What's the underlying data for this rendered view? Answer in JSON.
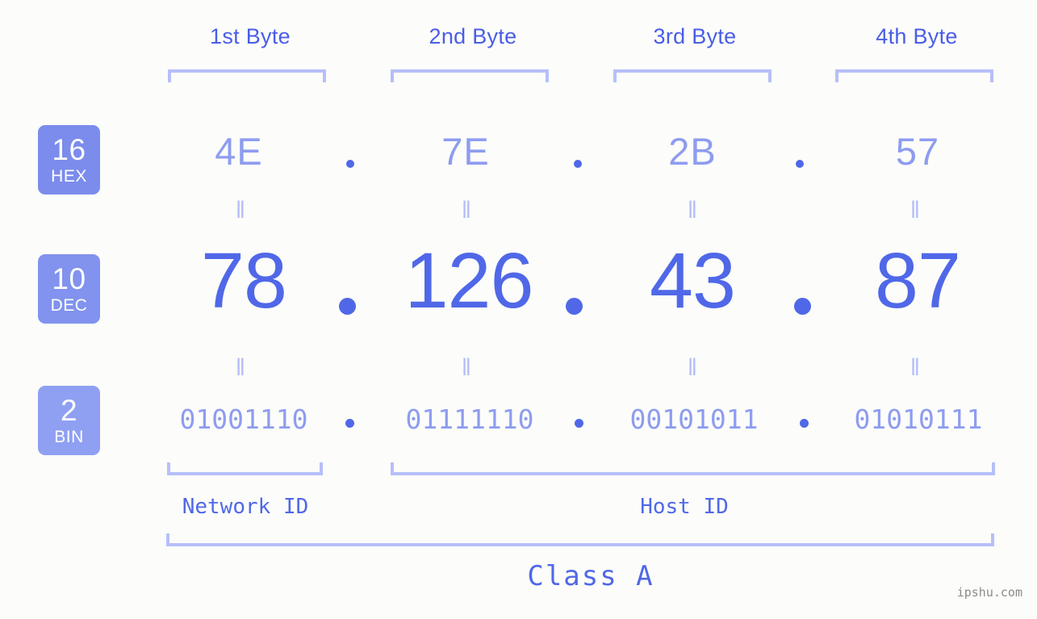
{
  "theme": {
    "background": "#fcfdfa",
    "accent_strong": "#5068e8",
    "accent_light": "#8e9cf0",
    "accent_pale": "#b6bffa",
    "badge_fill_hex": "#7b8cec",
    "badge_fill_dec": "#8193ee",
    "badge_fill_bin": "#8fa0f3",
    "header_text": "#4a5de8",
    "watermark_color": "#8a8a8a"
  },
  "header": {
    "bytes": [
      {
        "label": "1st Byte"
      },
      {
        "label": "2nd Byte"
      },
      {
        "label": "3rd Byte"
      },
      {
        "label": "4th Byte"
      }
    ]
  },
  "rows": {
    "hex": {
      "badge": {
        "num": "16",
        "name": "HEX"
      },
      "values": [
        "4E",
        "7E",
        "2B",
        "57"
      ],
      "separator": "."
    },
    "dec": {
      "badge": {
        "num": "10",
        "name": "DEC"
      },
      "values": [
        "78",
        "126",
        "43",
        "87"
      ],
      "separator": "."
    },
    "bin": {
      "badge": {
        "num": "2",
        "name": "BIN"
      },
      "values": [
        "01001110",
        "01111110",
        "00101011",
        "01010111"
      ],
      "separator": "."
    }
  },
  "equals": {
    "glyph": "‖",
    "hex_to_dec": [
      "‖",
      "‖",
      "‖",
      "‖"
    ],
    "dec_to_bin": [
      "‖",
      "‖",
      "‖",
      "‖"
    ]
  },
  "segments": {
    "network_id": "Network ID",
    "host_id": "Host ID",
    "class": "Class A"
  },
  "watermark": "ipshu.com"
}
